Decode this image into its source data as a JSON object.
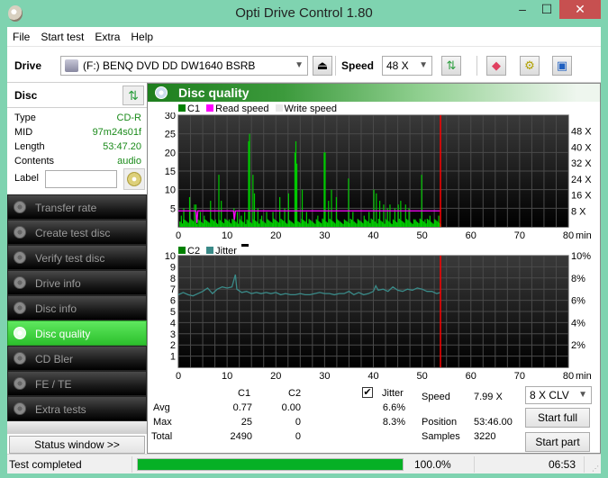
{
  "window": {
    "title": "Opti Drive Control 1.80",
    "min": "‒",
    "max": "☐",
    "close": "✕"
  },
  "menu": [
    "File",
    "Start test",
    "Extra",
    "Help"
  ],
  "toolbar": {
    "drive_label": "Drive",
    "drive_value": "(F:)  BENQ DVD DD DW1640 BSRB",
    "speed_label": "Speed",
    "speed_value": "48 X",
    "icons": [
      "eject-icon",
      "refresh-icon",
      "erase-icon",
      "settings-icon",
      "save-icon"
    ]
  },
  "disc": {
    "title": "Disc",
    "rows": [
      {
        "key": "Type",
        "value": "CD-R"
      },
      {
        "key": "MID",
        "value": "97m24s01f"
      },
      {
        "key": "Length",
        "value": "53:47.20"
      },
      {
        "key": "Contents",
        "value": "audio"
      }
    ],
    "label_key": "Label",
    "label_value": ""
  },
  "nav": [
    {
      "label": "Transfer rate",
      "active": false
    },
    {
      "label": "Create test disc",
      "active": false
    },
    {
      "label": "Verify test disc",
      "active": false
    },
    {
      "label": "Drive info",
      "active": false
    },
    {
      "label": "Disc info",
      "active": false
    },
    {
      "label": "Disc quality",
      "active": true
    },
    {
      "label": "CD Bler",
      "active": false
    },
    {
      "label": "FE / TE",
      "active": false
    },
    {
      "label": "Extra tests",
      "active": false
    }
  ],
  "status_window_btn": "Status window >>",
  "panel_title": "Disc quality",
  "colors": {
    "c1": "#00c800",
    "read_speed": "#ff00ff",
    "write_speed": "#e8e8e8",
    "c2": "#008000",
    "jitter": "#3a8a88",
    "marker": "#ff0000",
    "progress": "#06b025"
  },
  "chart_data": [
    {
      "type": "bar",
      "title": "C1 / Read speed",
      "legend": [
        "C1",
        "Read speed",
        "Write speed"
      ],
      "legend_position": "top-left",
      "xlabel": "min",
      "x_ticks": [
        0,
        10,
        20,
        30,
        40,
        50,
        60,
        70,
        80
      ],
      "xlim": [
        0,
        80
      ],
      "ylim": [
        0,
        30
      ],
      "y_ticks": [
        5,
        10,
        15,
        20,
        25,
        30
      ],
      "y2_ticks": [
        "8 X",
        "16 X",
        "24 X",
        "32 X",
        "40 X",
        "48 X"
      ],
      "y2lim": [
        0,
        56
      ],
      "grid": true,
      "end_marker_min": 53.77,
      "c1_spikes": [
        {
          "x": 0.5,
          "y": 3
        },
        {
          "x": 1.0,
          "y": 5
        },
        {
          "x": 2.2,
          "y": 8
        },
        {
          "x": 3.2,
          "y": 6
        },
        {
          "x": 3.5,
          "y": 6
        },
        {
          "x": 4.4,
          "y": 4
        },
        {
          "x": 5.2,
          "y": 3
        },
        {
          "x": 6.5,
          "y": 7
        },
        {
          "x": 7.5,
          "y": 2
        },
        {
          "x": 8.2,
          "y": 14
        },
        {
          "x": 8.7,
          "y": 7
        },
        {
          "x": 10.3,
          "y": 2
        },
        {
          "x": 11.3,
          "y": 5
        },
        {
          "x": 12.0,
          "y": 4
        },
        {
          "x": 12.8,
          "y": 3
        },
        {
          "x": 13.5,
          "y": 4
        },
        {
          "x": 14.3,
          "y": 23
        },
        {
          "x": 14.5,
          "y": 25
        },
        {
          "x": 15.2,
          "y": 14
        },
        {
          "x": 15.5,
          "y": 9
        },
        {
          "x": 16.2,
          "y": 5
        },
        {
          "x": 17.0,
          "y": 3
        },
        {
          "x": 18.0,
          "y": 4
        },
        {
          "x": 19.3,
          "y": 4
        },
        {
          "x": 20.7,
          "y": 8
        },
        {
          "x": 21.7,
          "y": 5
        },
        {
          "x": 22.5,
          "y": 9
        },
        {
          "x": 23.8,
          "y": 20
        },
        {
          "x": 24.0,
          "y": 23
        },
        {
          "x": 24.2,
          "y": 17
        },
        {
          "x": 25.3,
          "y": 10
        },
        {
          "x": 26.2,
          "y": 4
        },
        {
          "x": 28.5,
          "y": 3
        },
        {
          "x": 29.8,
          "y": 20
        },
        {
          "x": 30.0,
          "y": 20
        },
        {
          "x": 30.7,
          "y": 7
        },
        {
          "x": 31.3,
          "y": 10
        },
        {
          "x": 32.3,
          "y": 8
        },
        {
          "x": 34.8,
          "y": 13
        },
        {
          "x": 35.7,
          "y": 4
        },
        {
          "x": 38.0,
          "y": 3
        },
        {
          "x": 39.0,
          "y": 4
        },
        {
          "x": 40.0,
          "y": 10
        },
        {
          "x": 40.5,
          "y": 9
        },
        {
          "x": 41.2,
          "y": 7
        },
        {
          "x": 42.0,
          "y": 6
        },
        {
          "x": 42.8,
          "y": 5
        },
        {
          "x": 43.3,
          "y": 6
        },
        {
          "x": 44.3,
          "y": 5
        },
        {
          "x": 45.0,
          "y": 6
        },
        {
          "x": 45.5,
          "y": 7
        },
        {
          "x": 46.5,
          "y": 6
        },
        {
          "x": 47.2,
          "y": 5
        },
        {
          "x": 48.5,
          "y": 2
        },
        {
          "x": 49.8,
          "y": 14
        },
        {
          "x": 50.5,
          "y": 2
        },
        {
          "x": 51.5,
          "y": 3
        },
        {
          "x": 52.5,
          "y": 2
        },
        {
          "x": 53.3,
          "y": 3
        }
      ],
      "c1_baseline": 1.5,
      "read_speed_x": 8.0,
      "read_speed_dips": [
        {
          "x": 3.8,
          "v": 2.0
        },
        {
          "x": 11.5,
          "v": 3.5
        }
      ]
    },
    {
      "type": "line",
      "title": "C2 / Jitter",
      "legend": [
        "C2",
        "Jitter"
      ],
      "legend_position": "top-left",
      "xlabel": "min",
      "x_ticks": [
        0,
        10,
        20,
        30,
        40,
        50,
        60,
        70,
        80
      ],
      "xlim": [
        0,
        80
      ],
      "ylim": [
        0,
        10
      ],
      "y_ticks": [
        1,
        2,
        3,
        4,
        5,
        6,
        7,
        8,
        9,
        10
      ],
      "y2_ticks": [
        "2%",
        "4%",
        "6%",
        "8%",
        "10%"
      ],
      "y2lim": [
        0,
        10
      ],
      "grid": true,
      "end_marker_min": 53.77,
      "c2_values": "all 0",
      "jitter_points": [
        [
          0,
          6.5
        ],
        [
          1,
          6.7
        ],
        [
          2,
          6.5
        ],
        [
          3,
          6.4
        ],
        [
          4,
          6.6
        ],
        [
          5,
          6.8
        ],
        [
          6,
          7.1
        ],
        [
          7,
          6.6
        ],
        [
          8,
          7.0
        ],
        [
          9,
          7.2
        ],
        [
          10,
          7.1
        ],
        [
          11,
          7.2
        ],
        [
          11.7,
          8.3
        ],
        [
          12,
          7.0
        ],
        [
          13,
          6.7
        ],
        [
          14,
          6.8
        ],
        [
          15,
          6.6
        ],
        [
          16,
          6.7
        ],
        [
          17,
          6.6
        ],
        [
          18,
          6.7
        ],
        [
          19,
          6.6
        ],
        [
          20,
          6.7
        ],
        [
          21,
          6.5
        ],
        [
          22,
          6.6
        ],
        [
          23,
          6.5
        ],
        [
          24,
          6.5
        ],
        [
          25,
          6.6
        ],
        [
          26,
          6.5
        ],
        [
          27,
          6.5
        ],
        [
          28,
          6.6
        ],
        [
          29,
          6.7
        ],
        [
          30,
          6.6
        ],
        [
          31,
          6.6
        ],
        [
          32,
          6.5
        ],
        [
          33,
          6.6
        ],
        [
          34,
          6.6
        ],
        [
          35,
          6.8
        ],
        [
          36,
          6.5
        ],
        [
          37,
          6.7
        ],
        [
          38,
          6.5
        ],
        [
          39,
          6.6
        ],
        [
          40,
          6.8
        ],
        [
          40.5,
          7.3
        ],
        [
          41,
          6.9
        ],
        [
          42,
          7.0
        ],
        [
          43,
          6.8
        ],
        [
          44,
          7.2
        ],
        [
          45,
          6.9
        ],
        [
          46,
          6.8
        ],
        [
          47,
          7.0
        ],
        [
          48,
          6.9
        ],
        [
          49,
          7.1
        ],
        [
          50,
          7.0
        ],
        [
          51,
          6.8
        ],
        [
          52,
          6.8
        ],
        [
          53,
          6.6
        ],
        [
          53.77,
          6.7
        ]
      ]
    }
  ],
  "stats": {
    "col_c1": "C1",
    "col_c2": "C2",
    "jitter_label": "Jitter",
    "jitter_checked": true,
    "rows": [
      {
        "label": "Avg",
        "c1": "0.77",
        "c2": "0.00",
        "jitter": "6.6%"
      },
      {
        "label": "Max",
        "c1": "25",
        "c2": "0",
        "jitter": "8.3%"
      },
      {
        "label": "Total",
        "c1": "2490",
        "c2": "0",
        "jitter": ""
      }
    ],
    "speed_label": "Speed",
    "speed_value": "7.99 X",
    "position_label": "Position",
    "position_value": "53:46.00",
    "samples_label": "Samples",
    "samples_value": "3220",
    "mode_value": "8 X CLV",
    "start_full": "Start full",
    "start_part": "Start part"
  },
  "statusbar": {
    "text": "Test completed",
    "progress_pct": 100.0,
    "progress_text": "100.0%",
    "time": "06:53"
  }
}
